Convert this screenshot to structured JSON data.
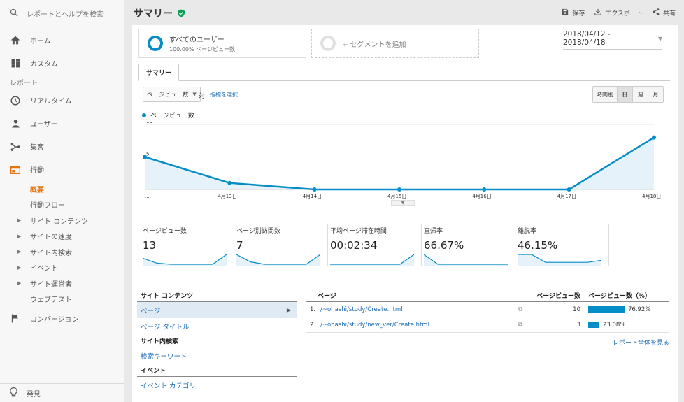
{
  "sidebar": {
    "search_label": "レポートとヘルプを検索",
    "items": [
      {
        "label": "ホーム",
        "icon": "home-icon"
      },
      {
        "label": "カスタム",
        "icon": "dashboard-icon"
      }
    ],
    "section_label": "レポート",
    "report_items": [
      {
        "label": "リアルタイム",
        "icon": "clock-icon"
      },
      {
        "label": "ユーザー",
        "icon": "person-icon"
      },
      {
        "label": "集客",
        "icon": "acquisition-icon"
      },
      {
        "label": "行動",
        "icon": "behavior-icon"
      }
    ],
    "sub_items": [
      {
        "label": "概要",
        "selected": true,
        "expandable": false
      },
      {
        "label": "行動フロー",
        "selected": false,
        "expandable": false
      },
      {
        "label": "サイト コンテンツ",
        "selected": false,
        "expandable": true
      },
      {
        "label": "サイトの速度",
        "selected": false,
        "expandable": true
      },
      {
        "label": "サイト内検索",
        "selected": false,
        "expandable": true
      },
      {
        "label": "イベント",
        "selected": false,
        "expandable": true
      },
      {
        "label": "サイト運営者",
        "selected": false,
        "expandable": true
      },
      {
        "label": "ウェブテスト",
        "selected": false,
        "expandable": false
      }
    ],
    "conversion_label": "コンバージョン",
    "discover_label": "発見"
  },
  "header": {
    "title": "サマリー",
    "save_label": "保存",
    "export_label": "エクスポート",
    "share_label": "共有"
  },
  "segments": {
    "all_users_name": "すべてのユーザー",
    "all_users_sub": "100.00% ページビュー数",
    "add_label": "+ セグメントを追加"
  },
  "date_range": "2018/04/12 - 2018/04/18",
  "tabs": [
    "サマリー"
  ],
  "controls": {
    "metric": "ページビュー数",
    "vs_label": "対",
    "select_metric": "指標を選択",
    "time_buttons": [
      "時間別",
      "日",
      "週",
      "月"
    ],
    "active_time": "日"
  },
  "chart_data": {
    "type": "area",
    "series": [
      {
        "name": "ページビュー数",
        "values": [
          5,
          1,
          0,
          0,
          0,
          0,
          8
        ]
      }
    ],
    "categories": [
      "...",
      "4月13日",
      "4月14日",
      "4月15日",
      "4月16日",
      "4月17日",
      "4月18日"
    ],
    "y_ticks": [
      "10",
      "5"
    ],
    "ylim": [
      0,
      10
    ],
    "color": "#058dc7"
  },
  "scorecards": [
    {
      "label": "ページビュー数",
      "value": "13",
      "spark": [
        5,
        1,
        0,
        0,
        0,
        0,
        8
      ]
    },
    {
      "label": "ページ別訪問数",
      "value": "7",
      "spark": [
        4,
        1,
        0,
        0,
        0,
        0,
        4
      ]
    },
    {
      "label": "平均ページ滞在時間",
      "value": "00:02:34",
      "spark": [
        0,
        0,
        0,
        0,
        0,
        0,
        6
      ]
    },
    {
      "label": "直帰率",
      "value": "66.67%",
      "spark": [
        6,
        0,
        0,
        0,
        0,
        0,
        0
      ]
    },
    {
      "label": "離脱率",
      "value": "46.15%",
      "spark": [
        5,
        5,
        1,
        1,
        1,
        1,
        2
      ]
    }
  ],
  "left_table": {
    "sections": [
      {
        "heading": "サイト コンテンツ",
        "links": [
          {
            "label": "ページ",
            "selected": true
          },
          {
            "label": "ページ タイトル",
            "selected": false
          }
        ]
      },
      {
        "heading": "サイト内検索",
        "links": [
          {
            "label": "検索キーワード",
            "selected": false
          }
        ]
      },
      {
        "heading": "イベント",
        "links": [
          {
            "label": "イベント カテゴリ",
            "selected": false
          }
        ]
      }
    ]
  },
  "right_table": {
    "headers": {
      "page": "ページ",
      "views": "ページビュー数",
      "pct": "ページビュー数（%）"
    },
    "rows": [
      {
        "idx": "1.",
        "page": "/~ohashi/study/Create.html",
        "views": "10",
        "pct": "76.92%",
        "fraction": 0.7692
      },
      {
        "idx": "2.",
        "page": "/~ohashi/study/new_ver/Create.html",
        "views": "3",
        "pct": "23.08%",
        "fraction": 0.2308
      }
    ],
    "see_all": "レポート全体を見る"
  }
}
